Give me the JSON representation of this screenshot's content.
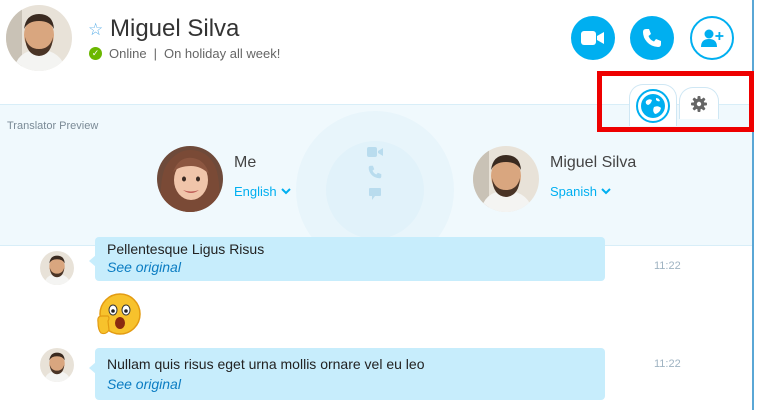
{
  "contact": {
    "name": "Miguel Silva",
    "status": "Online",
    "separator": "|",
    "mood": "On holiday all week!"
  },
  "header": {
    "actions": [
      {
        "icon": "video-camera-icon"
      },
      {
        "icon": "phone-icon"
      },
      {
        "icon": "add-person-icon"
      }
    ],
    "tabs": [
      {
        "icon": "translator-globe-icon",
        "selected": true
      },
      {
        "icon": "gear-icon",
        "selected": false
      }
    ]
  },
  "translator": {
    "title": "Translator Preview",
    "me": {
      "name": "Me",
      "language": "English"
    },
    "contact": {
      "name": "Miguel Silva",
      "language": "Spanish"
    }
  },
  "messages": [
    {
      "text": "Pellentesque Ligus Risus",
      "link": "See original",
      "time": "11:22"
    },
    {
      "emoticon": "surprised-emoticon"
    },
    {
      "text": "Nullam quis risus eget urna mollis ornare vel eu leo",
      "link": "See original",
      "time": "11:22"
    }
  ],
  "colors": {
    "accent": "#00aff0",
    "online": "#6bb700",
    "bubble": "#c7edfc",
    "highlight": "#ee0000",
    "panel": "#f0f9fd"
  }
}
